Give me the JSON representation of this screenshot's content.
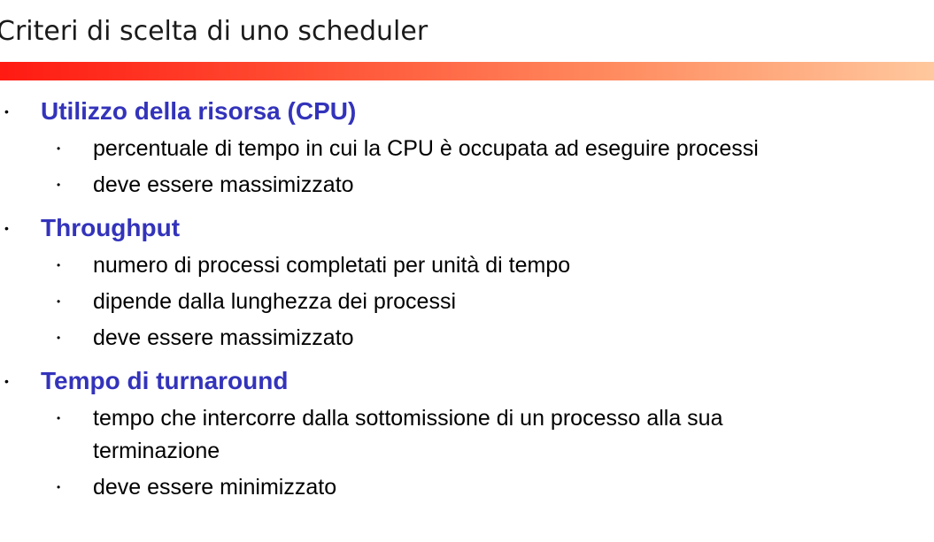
{
  "slide": {
    "title": "Criteri di scelta di uno scheduler",
    "accent_gradient": [
      "#ff1a12",
      "#ff4a30",
      "#ff8a5e",
      "#ffc89e"
    ],
    "heading_color": "#3333bb",
    "bullet_glyph": "•",
    "sub_bullet_glyph": "•"
  },
  "sections": [
    {
      "heading": "Utilizzo della risorsa (CPU)",
      "items": [
        "percentuale di tempo in cui la CPU è occupata ad eseguire processi",
        "deve essere massimizzato"
      ]
    },
    {
      "heading": "Throughput",
      "items": [
        "numero di processi completati per unità di tempo",
        "dipende dalla lunghezza dei processi",
        "deve essere massimizzato"
      ]
    },
    {
      "heading": "Tempo di turnaround",
      "items": [
        "tempo che intercorre dalla sottomissione di un processo alla sua terminazione",
        "deve essere minimizzato"
      ]
    }
  ]
}
